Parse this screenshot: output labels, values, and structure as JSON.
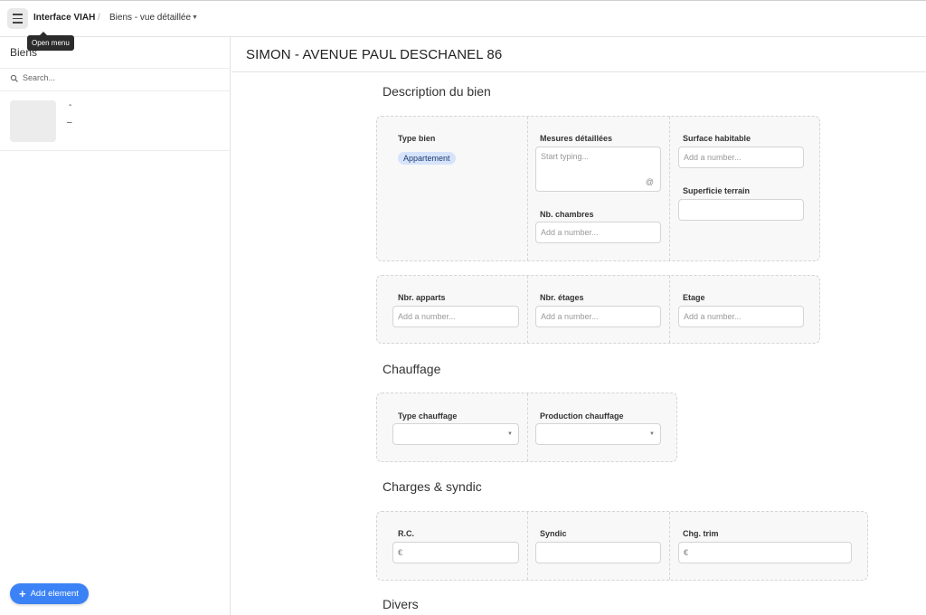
{
  "topbar": {
    "app_title": "Interface VIAH",
    "separator": "/",
    "view_name": "Biens - vue détaillée",
    "tooltip": "Open menu"
  },
  "sidebar": {
    "title": "Biens",
    "search_placeholder": "Search...",
    "records": [
      {
        "line1": "-",
        "line2": "–"
      }
    ],
    "add_button": "Add element"
  },
  "main": {
    "page_title": "SIMON - AVENUE PAUL DESCHANEL 86",
    "sections": {
      "description": "Description du bien",
      "chauffage": "Chauffage",
      "charges": "Charges & syndic",
      "divers": "Divers"
    },
    "fields": {
      "type_bien": {
        "label": "Type bien",
        "value": "Appartement"
      },
      "mesures": {
        "label": "Mesures détaillées",
        "placeholder": "Start typing..."
      },
      "surface_habitable": {
        "label": "Surface habitable",
        "placeholder": "Add a number..."
      },
      "superficie_terrain": {
        "label": "Superficie terrain",
        "placeholder": ""
      },
      "nb_chambres": {
        "label": "Nb. chambres",
        "placeholder": "Add a number..."
      },
      "nbr_apparts": {
        "label": "Nbr. apparts",
        "placeholder": "Add a number..."
      },
      "nbr_etages": {
        "label": "Nbr. étages",
        "placeholder": "Add a number..."
      },
      "etage": {
        "label": "Etage",
        "placeholder": "Add a number..."
      },
      "type_chauffage": {
        "label": "Type chauffage",
        "value": ""
      },
      "production_chauffage": {
        "label": "Production chauffage",
        "value": ""
      },
      "rc": {
        "label": "R.C.",
        "currency": "€"
      },
      "syndic": {
        "label": "Syndic",
        "value": ""
      },
      "chg_trim": {
        "label": "Chg. trim",
        "currency": "€"
      }
    },
    "mention_icon": "@"
  },
  "colors": {
    "accent": "#3b82f6",
    "tag_bg": "#d6e4fb",
    "panel_bg": "#f8f8f8"
  }
}
